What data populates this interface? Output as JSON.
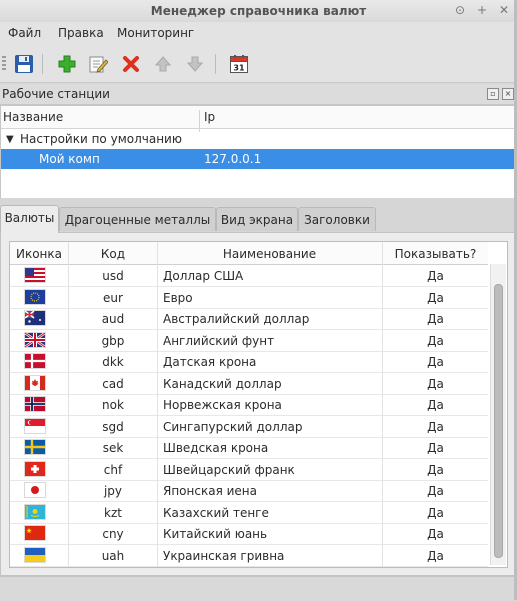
{
  "window": {
    "title": "Менеджер справочника валют",
    "controls": [
      "⊙",
      "+",
      "✕"
    ]
  },
  "menu": [
    "Файл",
    "Правка",
    "Мониторинг"
  ],
  "toolbar": {
    "buttons": [
      "save-icon",
      "add-icon",
      "edit-icon",
      "delete-icon",
      "move-up-icon",
      "move-down-icon",
      "calendar-icon"
    ],
    "calendar_day": "31"
  },
  "workstations": {
    "title": "Рабочие станции",
    "columns": [
      "Название",
      "Ip"
    ],
    "group": "Настройки по умолчанию",
    "item": {
      "name": "Мой комп",
      "ip": "127.0.0.1"
    },
    "selection_color": "#3a8ee6"
  },
  "tabs": [
    "Валюты",
    "Драгоценные металлы",
    "Вид экрана",
    "Заголовки"
  ],
  "active_tab": 0,
  "currencies": {
    "columns": [
      "Иконка",
      "Код",
      "Наименование",
      "Показывать?"
    ],
    "rows": [
      {
        "flag": "us",
        "code": "usd",
        "name": "Доллар США",
        "show": "Да"
      },
      {
        "flag": "eu",
        "code": "eur",
        "name": "Евро",
        "show": "Да"
      },
      {
        "flag": "au",
        "code": "aud",
        "name": "Австралийский доллар",
        "show": "Да"
      },
      {
        "flag": "gb",
        "code": "gbp",
        "name": "Английский фунт",
        "show": "Да"
      },
      {
        "flag": "dk",
        "code": "dkk",
        "name": "Датская крона",
        "show": "Да"
      },
      {
        "flag": "ca",
        "code": "cad",
        "name": "Канадский доллар",
        "show": "Да"
      },
      {
        "flag": "no",
        "code": "nok",
        "name": "Норвежская крона",
        "show": "Да"
      },
      {
        "flag": "sg",
        "code": "sgd",
        "name": "Сингапурский доллар",
        "show": "Да"
      },
      {
        "flag": "se",
        "code": "sek",
        "name": "Шведская крона",
        "show": "Да"
      },
      {
        "flag": "ch",
        "code": "chf",
        "name": "Швейцарский франк",
        "show": "Да"
      },
      {
        "flag": "jp",
        "code": "jpy",
        "name": "Японская иена",
        "show": "Да"
      },
      {
        "flag": "kz",
        "code": "kzt",
        "name": "Казахский тенге",
        "show": "Да"
      },
      {
        "flag": "cn",
        "code": "cny",
        "name": "Китайский юань",
        "show": "Да"
      },
      {
        "flag": "ua",
        "code": "uah",
        "name": "Украинская гривна",
        "show": "Да"
      }
    ]
  }
}
